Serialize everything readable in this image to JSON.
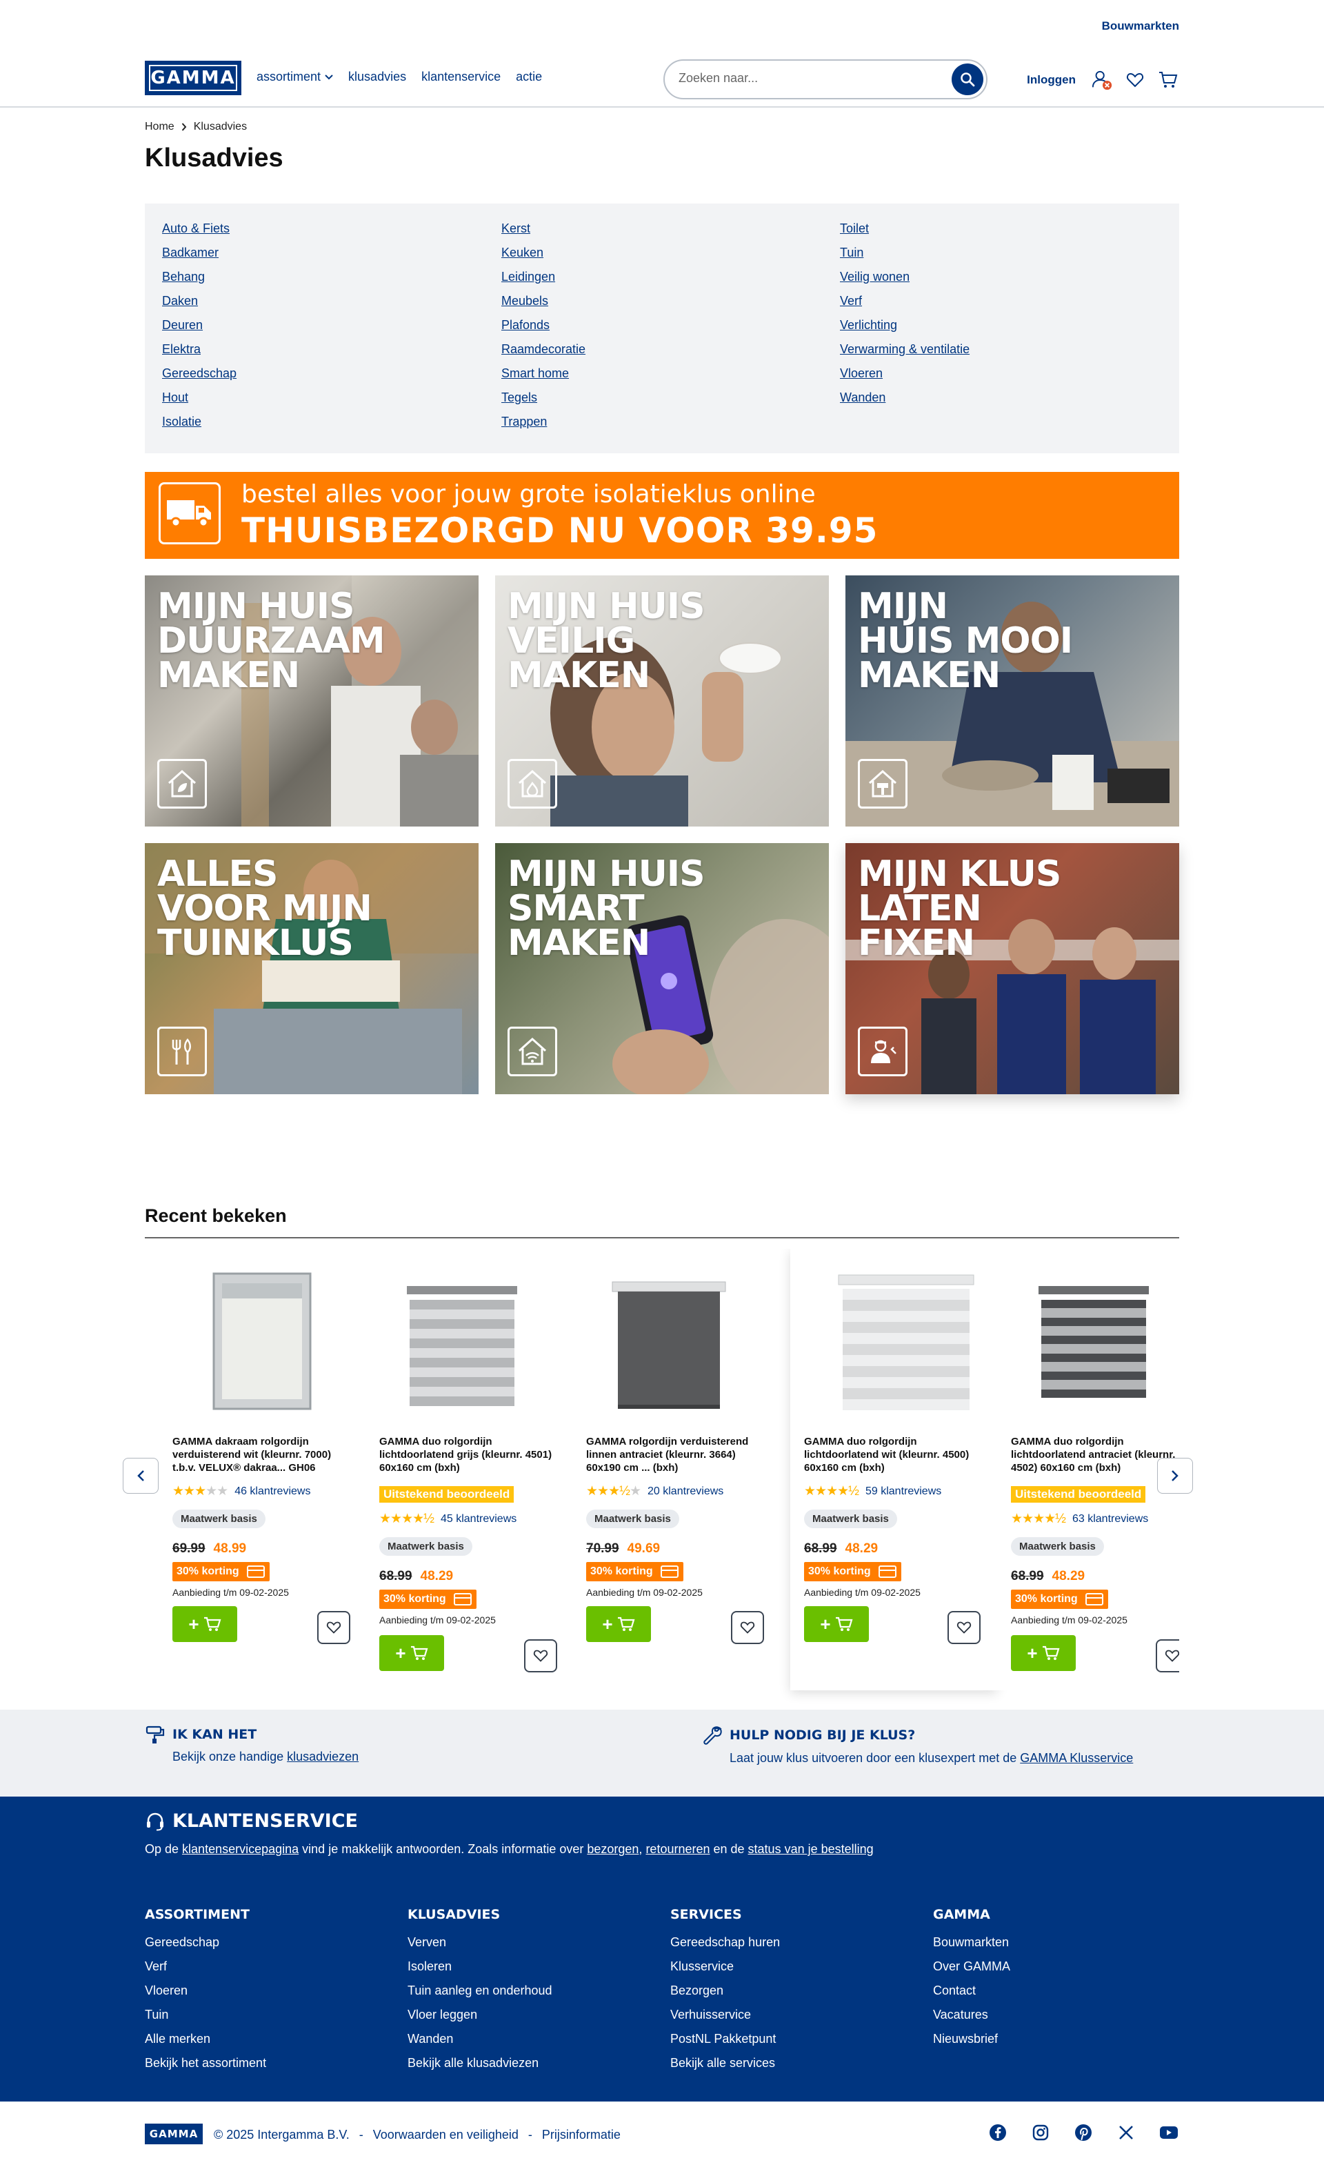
{
  "topbar": {
    "stores_link": "Bouwmarkten"
  },
  "header": {
    "logo": "GAMMA",
    "nav": [
      {
        "label": "assortiment",
        "has_dropdown": true
      },
      {
        "label": "klusadvies"
      },
      {
        "label": "klantenservice"
      },
      {
        "label": "actie"
      }
    ],
    "search": {
      "placeholder": "Zoeken naar..."
    },
    "login_label": "Inloggen"
  },
  "breadcrumb": {
    "items": [
      "Home",
      "Klusadvies"
    ]
  },
  "page_title": "Klusadvies",
  "categories": {
    "col1": [
      "Auto & Fiets",
      "Badkamer",
      "Behang",
      "Daken",
      "Deuren",
      "Elektra",
      "Gereedschap",
      "Hout",
      "Isolatie"
    ],
    "col2": [
      "Kerst",
      "Keuken",
      "Leidingen",
      "Meubels",
      "Plafonds",
      "Raamdecoratie",
      "Smart home",
      "Tegels",
      "Trappen"
    ],
    "col3": [
      "Toilet",
      "Tuin",
      "Veilig wonen",
      "Verf",
      "Verlichting",
      "Verwarming & ventilatie",
      "Vloeren",
      "Wanden"
    ]
  },
  "promo": {
    "line1": "bestel alles voor jouw grote isolatieklus online",
    "line2": "THUISBEZORGD NU VOOR 39.95"
  },
  "tiles": [
    {
      "title": "MIJN HUIS\nDUURZAAM\nMAKEN",
      "icon": "house-leaf-icon"
    },
    {
      "title": "MIJN HUIS\nVEILIG\nMAKEN",
      "icon": "house-fire-icon"
    },
    {
      "title": "MIJN\nHUIS MOOI\nMAKEN",
      "icon": "house-paint-icon"
    },
    {
      "title": "ALLES\nVOOR MIJN\nTUINKLUS",
      "icon": "garden-tools-icon"
    },
    {
      "title": "MIJN HUIS\nSMART\nMAKEN",
      "icon": "house-wifi-icon"
    },
    {
      "title": "MIJN KLUS\nLATEN\nFIXEN",
      "icon": "handyman-icon"
    }
  ],
  "recent": {
    "title": "Recent bekeken",
    "products": [
      {
        "name": "GAMMA dakraam rolgordijn verduisterend wit (kleurnr. 7000) t.b.v. VELUX® dakraa... GH06",
        "rating": 3,
        "reviews": "46 klantreviews",
        "badge": "",
        "tag": "Maatwerk basis",
        "old_price": "69.99",
        "new_price": "48.99",
        "discount": "30% korting",
        "valid": "Aanbieding t/m 09-02-2025"
      },
      {
        "name": "GAMMA duo rolgordijn lichtdoorlatend grijs (kleurnr. 4501) 60x160 cm (bxh)",
        "rating": 4.5,
        "reviews": "45 klantreviews",
        "badge": "Uitstekend beoordeeld",
        "tag": "Maatwerk basis",
        "old_price": "68.99",
        "new_price": "48.29",
        "discount": "30% korting",
        "valid": "Aanbieding t/m 09-02-2025"
      },
      {
        "name": "GAMMA rolgordijn verduisterend linnen antraciet (kleurnr. 3664) 60x190 cm ... (bxh)",
        "rating": 3.5,
        "reviews": "20 klantreviews",
        "badge": "",
        "tag": "Maatwerk basis",
        "old_price": "70.99",
        "new_price": "49.69",
        "discount": "30% korting",
        "valid": "Aanbieding t/m 09-02-2025"
      },
      {
        "name": "GAMMA duo rolgordijn lichtdoorlatend wit (kleurnr. 4500) 60x160 cm (bxh)",
        "rating": 4.5,
        "reviews": "59 klantreviews",
        "badge": "",
        "tag": "Maatwerk basis",
        "old_price": "68.99",
        "new_price": "48.29",
        "discount": "30% korting",
        "valid": "Aanbieding t/m 09-02-2025"
      },
      {
        "name": "GAMMA duo rolgordijn lichtdoorlatend antraciet (kleurnr. 4502) 60x160 cm (bxh)",
        "rating": 4.5,
        "reviews": "63 klantreviews",
        "badge": "Uitstekend beoordeeld",
        "tag": "Maatwerk basis",
        "old_price": "68.99",
        "new_price": "48.29",
        "discount": "30% korting",
        "valid": "Aanbieding t/m 09-02-2025"
      }
    ]
  },
  "tips": {
    "left": {
      "title": "IK KAN HET",
      "text": "Bekijk onze handige ",
      "link": "klusadviezen"
    },
    "right": {
      "title": "HULP NODIG BIJ JE KLUS?",
      "text": "Laat jouw klus uitvoeren door een klusexpert met de ",
      "link": "GAMMA Klusservice"
    }
  },
  "footer": {
    "title": "KLANTENSERVICE",
    "text_a": "Op de ",
    "link_a": "klantenservicepagina",
    "text_b": " vind je makkelijk antwoorden. Zoals informatie over ",
    "link_b": "bezorgen",
    "text_c": ", ",
    "link_c": "retourneren",
    "text_d": " en de ",
    "link_d": "status van je bestelling",
    "columns": [
      {
        "heading": "ASSORTIMENT",
        "links": [
          "Gereedschap",
          "Verf",
          "Vloeren",
          "Tuin",
          "Alle merken",
          "Bekijk het assortiment"
        ]
      },
      {
        "heading": "KLUSADVIES",
        "links": [
          "Verven",
          "Isoleren",
          "Tuin aanleg en onderhoud",
          "Vloer leggen",
          "Wanden",
          "Bekijk alle klusadviezen"
        ]
      },
      {
        "heading": "SERVICES",
        "links": [
          "Gereedschap huren",
          "Klusservice",
          "Bezorgen",
          "Verhuisservice",
          "PostNL Pakketpunt",
          "Bekijk alle services"
        ]
      },
      {
        "heading": "GAMMA",
        "links": [
          "Bouwmarkten",
          "Over GAMMA",
          "Contact",
          "Vacatures",
          "Nieuwsbrief"
        ]
      }
    ]
  },
  "bottom": {
    "logo": "GAMMA",
    "copyright": "© 2025 Intergamma B.V.",
    "sep": "-",
    "terms": "Voorwaarden en veiligheid",
    "prices": "Prijsinformatie",
    "socials": [
      "facebook-icon",
      "instagram-icon",
      "pinterest-icon",
      "x-icon",
      "youtube-icon"
    ]
  },
  "colors": {
    "brand_blue": "#003580",
    "accent_orange": "#ff7d00",
    "cart_green": "#6abf00",
    "badge_yellow": "#ffc20e"
  }
}
